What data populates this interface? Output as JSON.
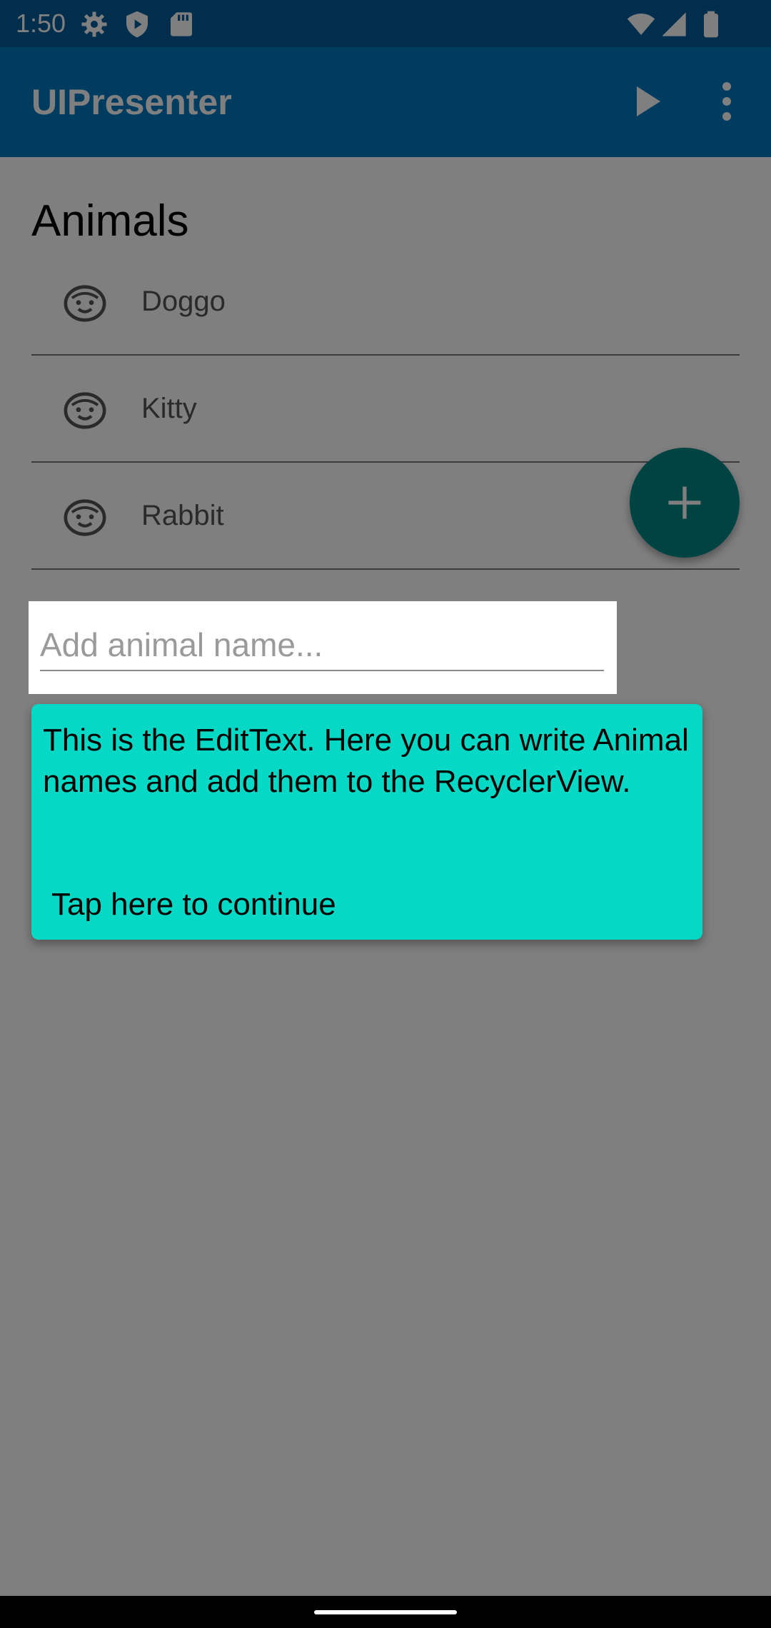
{
  "status_bar": {
    "time": "1:50",
    "icons": [
      "settings-icon",
      "shield-icon",
      "sd-card-icon",
      "wifi-icon",
      "signal-icon",
      "battery-icon"
    ]
  },
  "toolbar": {
    "title": "UIPresenter",
    "actions": [
      "play-icon",
      "more-vert-icon"
    ]
  },
  "main": {
    "section_title": "Animals",
    "animals": [
      {
        "name": "Doggo",
        "icon": "face-icon"
      },
      {
        "name": "Kitty",
        "icon": "face-icon"
      },
      {
        "name": "Rabbit",
        "icon": "face-icon"
      }
    ],
    "input": {
      "value": "",
      "placeholder": "Add animal name..."
    },
    "fab": {
      "icon": "plus-icon"
    }
  },
  "tooltip": {
    "message": "This is the EditText. Here you can write Animal names and add them to the RecyclerView.",
    "continue_text": "Tap here to continue"
  },
  "colors": {
    "primary": "#0179c1",
    "primary_dark": "#015d99",
    "accent": "#018786",
    "tooltip_bg": "#05d9c6",
    "scrim": "#00000080"
  }
}
